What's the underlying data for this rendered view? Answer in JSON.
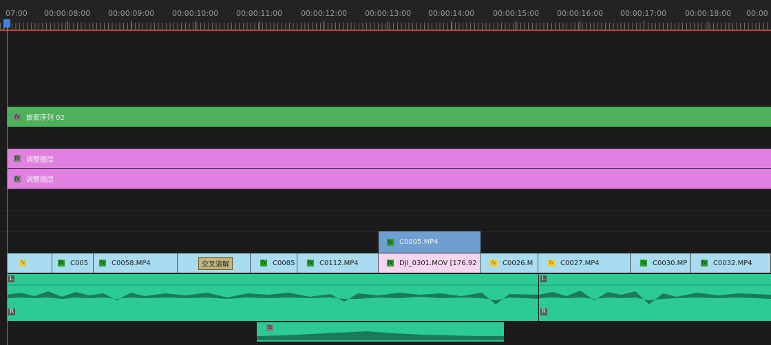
{
  "ruler": {
    "timecodes": [
      "07:00",
      "00:00:08:00",
      "00:00:09:00",
      "00:00:10:00",
      "00:00:11:00",
      "00:00:12:00",
      "00:00:13:00",
      "00:00:14:00",
      "00:00:15:00",
      "00:00:16:00",
      "00:00:17:00",
      "00:00:18:00",
      "00:00"
    ]
  },
  "tracks": {
    "nested_sequence": {
      "label": "嵌套序列 02",
      "icon": "fx-icon",
      "color": "#4db05a"
    },
    "adjustment_layer_1": {
      "label": "调整图层",
      "icon": "fx-icon",
      "color": "#e080e0"
    },
    "adjustment_layer_2": {
      "label": "调整图层",
      "icon": "fx-icon",
      "color": "#e080e0"
    },
    "overlay_clip": {
      "label": "C0005.MP4",
      "icon": "fx-icon",
      "color": "#6f9fd0"
    },
    "video_clips": [
      {
        "label": "",
        "icon": "fx-yellow"
      },
      {
        "label": "C005",
        "icon": "fx-green"
      },
      {
        "label": "C0058.MP4",
        "icon": "fx-green"
      },
      {
        "label": "交叉溶解",
        "icon": ""
      },
      {
        "label": "C0085",
        "icon": "fx-green"
      },
      {
        "label": "C0112.MP4",
        "icon": "fx-green"
      },
      {
        "label": "DJI_0301.MOV [176.92",
        "icon": "fx-green"
      },
      {
        "label": "C0026.M",
        "icon": "fx-yellow"
      },
      {
        "label": "C0027.MP4",
        "icon": "fx-yellow"
      },
      {
        "label": "C0030.MP",
        "icon": "fx-green"
      },
      {
        "label": "C0032.MP4",
        "icon": "fx-green"
      }
    ],
    "audio": {
      "channel_l": "L",
      "channel_r": "R",
      "color": "#2dcb94"
    }
  },
  "colors": {
    "playhead": "#3d82e0",
    "work_area": "#d33a3a",
    "video_clip": "#a9dcf1",
    "selected_clip": "#f6d6ef"
  }
}
